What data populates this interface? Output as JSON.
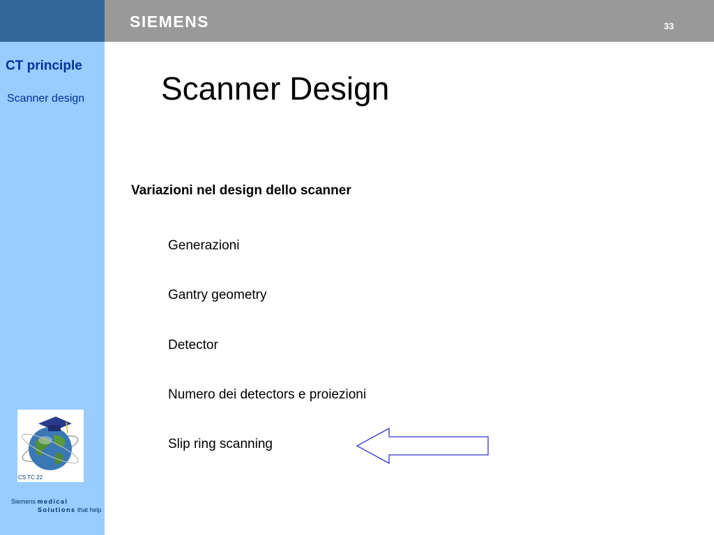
{
  "header": {
    "brand": "SIEMENS",
    "page_number": "33"
  },
  "sidebar": {
    "section": "CT principle",
    "subsection": "Scanner design",
    "logo_caption": "CS TC 22",
    "footer": {
      "word1": "Siemens",
      "word2": "medical",
      "word3": "Solutions",
      "word4": "that help"
    }
  },
  "slide": {
    "title": "Scanner Design",
    "subtitle": "Variazioni nel design dello scanner",
    "bullets": [
      "Generazioni",
      "Gantry geometry",
      "Detector",
      "Numero dei detectors e proiezioni",
      "Slip ring scanning"
    ],
    "arrow_color": "#3333cc"
  }
}
